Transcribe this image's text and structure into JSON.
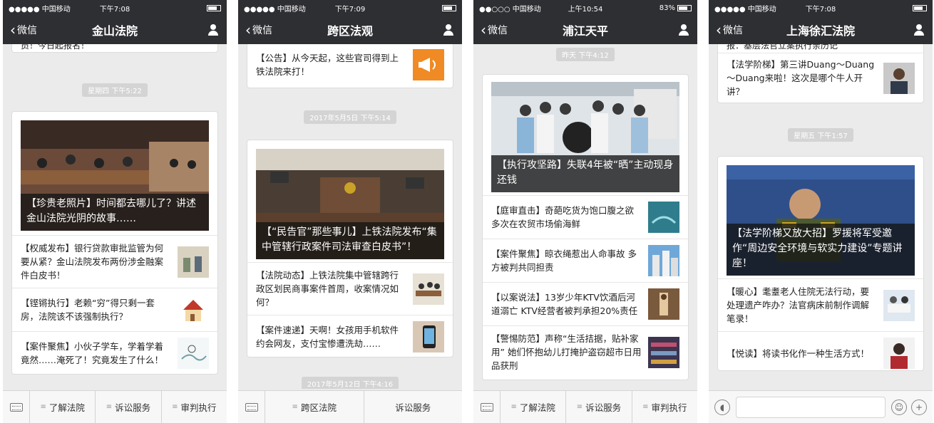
{
  "phones": [
    {
      "status": {
        "carrier": "●●●●● 中国移动",
        "time": "下午7:08"
      },
      "nav": {
        "back": "微信",
        "title": "金山法院"
      },
      "top_snippet": "员！今日起报名！",
      "timestamp": "星期四 下午5:22",
      "hero_caption": "【珍贵老照片】时间都去哪儿了？讲述金山法院光阴的故事……",
      "items": [
        "【权威发布】银行贷款审批监管为何要从紧？金山法院发布两份涉金融案件白皮书！",
        "【铿锵执行】老赖“穷”得只剩一套房，法院该不该强制执行？",
        "【案件聚焦】小伙子学车，学着学着竟然……淹死了！究竟发生了什么！"
      ],
      "menu": [
        "了解法院",
        "诉讼服务",
        "审判执行"
      ]
    },
    {
      "status": {
        "carrier": "●●●●● 中国移动",
        "time": "下午7:09"
      },
      "nav": {
        "back": "微信",
        "title": "跨区法观"
      },
      "top_item": "【公告】从今天起，这些官司得到上铁法院来打！",
      "timestamp": "2017年5月5日 下午5:14",
      "hero_caption": "【“民告官”那些事儿】上铁法院发布“集中管辖行政案件司法审查白皮书”！",
      "items": [
        "【法院动态】上铁法院集中管辖跨行政区划民商事案件首周，收案情况如何？",
        "【案件速递】天啊！女孩用手机软件约会网友，支付宝惨遭洗劫……"
      ],
      "bottom_timestamp": "2017年5月12日 下午4:16",
      "menu": [
        "跨区法院",
        "诉讼服务"
      ]
    },
    {
      "status": {
        "carrier": "●●○○○ 中国移动",
        "time": "上午10:54",
        "battery": "83%"
      },
      "nav": {
        "back": "微信",
        "title": "浦江天平"
      },
      "timestamp": "昨天 下午4:12",
      "hero_caption": "【执行攻坚路】失联4年被“晒”主动现身还钱",
      "items": [
        "【庭审直击】奇葩吃货为饱口腹之欲 多次在农贸市场偷海鲜",
        "【案件聚焦】晾衣绳惹出人命事故 多方被判共同担责",
        "【以案说法】13岁少年KTV饮酒后河道溺亡 KTV经营者被判承担20%责任",
        "【警惕防范】声称“生活拮据，贴补家用” 她们怀抱幼儿打掩护盗窃超市日用品获刑"
      ],
      "menu": [
        "了解法院",
        "诉讼服务",
        "审判执行"
      ]
    },
    {
      "status": {
        "carrier": "●●●●● 中国移动",
        "time": "下午7:08"
      },
      "nav": {
        "back": "微信",
        "title": "上海徐汇法院"
      },
      "top_snippet": "报：基层法官立案执行亲历记",
      "top_item": "【法学阶梯】第三讲Duang～Duang～Duang来啦！这次是哪个牛人开讲？",
      "timestamp": "星期五 下午1:57",
      "hero_caption": "【法学阶梯又放大招】罗援将军受邀作“周边安全环境与软实力建设”专题讲座！",
      "items": [
        "【暖心】耄耋老人住院无法行动，要处理遗产咋办？法官病床前制作调解笔录！",
        "【悦读】将读书化作一种生活方式！"
      ]
    }
  ]
}
